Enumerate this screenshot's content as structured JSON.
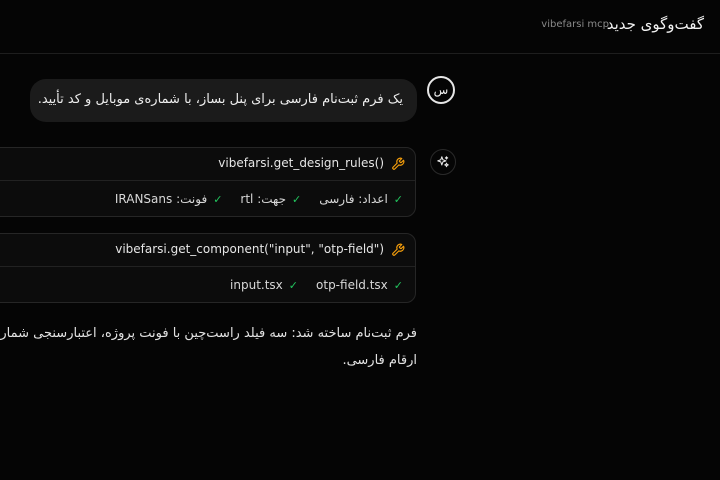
{
  "header": {
    "title": "گفت‌وگوی جدید",
    "subtitle": "vibefarsi mcp"
  },
  "user": {
    "avatar_letter": "س",
    "message": "یک فرم ثبت‌نام فارسی برای پنل بساز، با شماره‌ی موبایل و کد تأیید."
  },
  "assistant": {
    "icon": "sparkles-icon",
    "tool_calls": [
      {
        "icon": "wrench-icon",
        "name": "vibefarsi.get_design_rules()",
        "results": [
          "فونت: IRANSans",
          "جهت: rtl",
          "اعداد: فارسی"
        ]
      },
      {
        "icon": "wrench-icon",
        "name": "vibefarsi.get_component(\"input\", \"otp-field\")",
        "results": [
          "input.tsx",
          "otp-field.tsx"
        ]
      }
    ],
    "answer_lines": [
      "فرم ثبت‌نام ساخته شد: سه فیلد راست‌چین با فونت پروژه، اعتبارسنجی شماره‌ی",
      "ارقام فارسی."
    ]
  },
  "colors": {
    "background": "#050505",
    "bubble": "#1b1b1b",
    "check": "#22c55e",
    "wrench": "#f59e0b"
  }
}
